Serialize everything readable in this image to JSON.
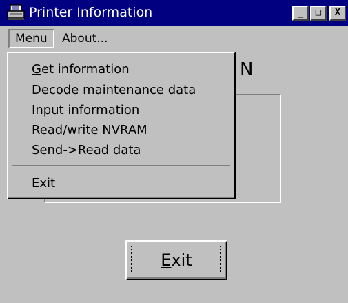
{
  "window": {
    "title": "Printer Information",
    "controls": {
      "minimize": "_",
      "maximize": "□",
      "close": "X"
    }
  },
  "menubar": {
    "items": [
      {
        "label": "Menu",
        "mnemonic": "M",
        "rest": "enu"
      },
      {
        "label": "About...",
        "mnemonic": "A",
        "rest": "bout..."
      }
    ]
  },
  "dropdown": {
    "items": [
      {
        "label": "Get information",
        "mnemonic": "G",
        "rest": "et information"
      },
      {
        "label": "Decode maintenance data",
        "mnemonic": "D",
        "rest": "ecode maintenance data"
      },
      {
        "label": "Input information",
        "mnemonic": "I",
        "rest": "nput information"
      },
      {
        "label": "Read/write NVRAM",
        "mnemonic": "R",
        "rest": "ead/write NVRAM"
      },
      {
        "label": "Send->Read data",
        "mnemonic": "S",
        "rest": "end->Read data"
      }
    ],
    "exit_item": {
      "label": "Exit",
      "mnemonic": "E",
      "rest": "xit"
    }
  },
  "content": {
    "partial_heading": "N",
    "exit_button": {
      "mnemonic": "E",
      "rest": "xit"
    }
  },
  "colors": {
    "titlebar": "#000080",
    "face": "#c0c0c0",
    "shadow": "#808080",
    "highlight": "#ffffff"
  },
  "icons": {
    "app": "printer-icon"
  }
}
